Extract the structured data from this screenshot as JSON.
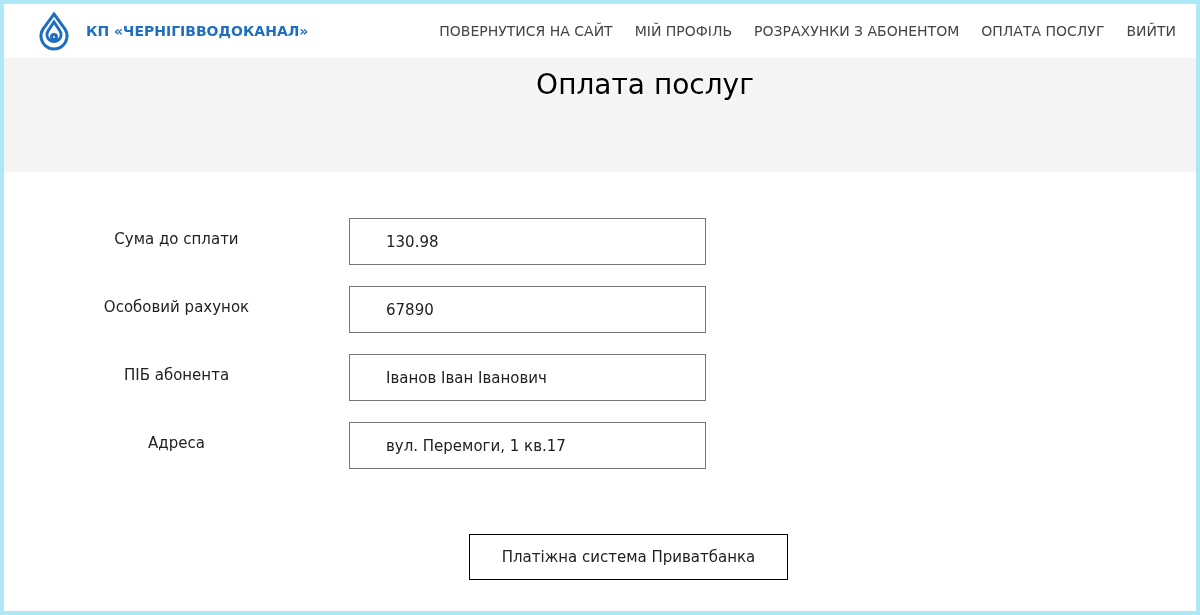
{
  "brand": {
    "name": "КП «ЧЕРНІГІВВОДОКАНАЛ»"
  },
  "nav": [
    "ПОВЕРНУТИСЯ НА САЙТ",
    "МІЙ ПРОФІЛЬ",
    "РОЗРАХУНКИ З АБОНЕНТОМ",
    "ОПЛАТА ПОСЛУГ",
    "ВИЙТИ"
  ],
  "page_title": "Оплата послуг",
  "fields": [
    {
      "label": "Сума до сплати",
      "value": "130.98"
    },
    {
      "label": "Особовий рахунок",
      "value": "67890"
    },
    {
      "label": "ПІБ абонента",
      "value": "Іванов Іван Іванович"
    },
    {
      "label": "Адреса",
      "value": "вул. Перемоги, 1 кв.17"
    }
  ],
  "submit_button": "Платіжна система Приватбанка"
}
